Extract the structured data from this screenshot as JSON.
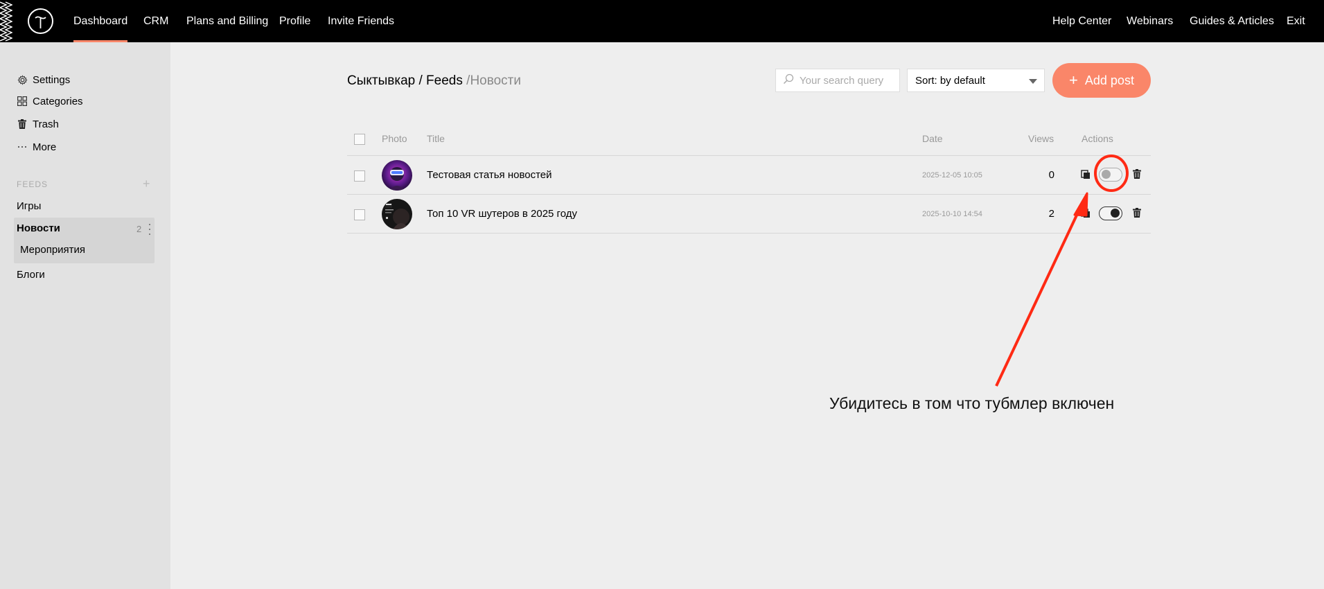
{
  "topbar": {
    "nav": [
      "Dashboard",
      "CRM",
      "Plans and Billing",
      "Profile",
      "Invite Friends"
    ],
    "right_nav": [
      "Help Center",
      "Webinars",
      "Guides & Articles",
      "Exit"
    ],
    "active": "Dashboard",
    "accent_color": "#fa8669"
  },
  "sidebar": {
    "links": [
      {
        "label": "Settings",
        "icon": "gear-icon"
      },
      {
        "label": "Categories",
        "icon": "grid-icon"
      },
      {
        "label": "Trash",
        "icon": "trash-icon"
      },
      {
        "label": "More",
        "icon": "more-icon"
      }
    ],
    "feeds_label": "FEEDS",
    "feeds_add": "+",
    "feeds": [
      {
        "label": "Игры"
      },
      {
        "label": "Новости",
        "count": "2",
        "active": true
      },
      {
        "label": "Мероприятия",
        "sub": true
      },
      {
        "label": "Блоги"
      }
    ]
  },
  "header": {
    "breadcrumb_root": "Сыктывкар / Feeds",
    "breadcrumb_sep": " /",
    "breadcrumb_current": "Новости",
    "search_placeholder": "Your search query",
    "sort_label": "Sort: by default",
    "add_post_label": "Add post",
    "add_post_icon": "+"
  },
  "table": {
    "columns": [
      "Photo",
      "Title",
      "Date",
      "Views",
      "Actions"
    ],
    "rows": [
      {
        "title": "Тестовая статья новостей",
        "date": "2025-12-05 10:05",
        "views": "0",
        "published": false
      },
      {
        "title": "Топ 10 VR шутеров в 2025 году",
        "date": "2025-10-10 14:54",
        "views": "2",
        "published": true
      }
    ]
  },
  "annotation": {
    "text": "Убидитесь в том что тубмлер включен",
    "color": "#ff2a14"
  }
}
